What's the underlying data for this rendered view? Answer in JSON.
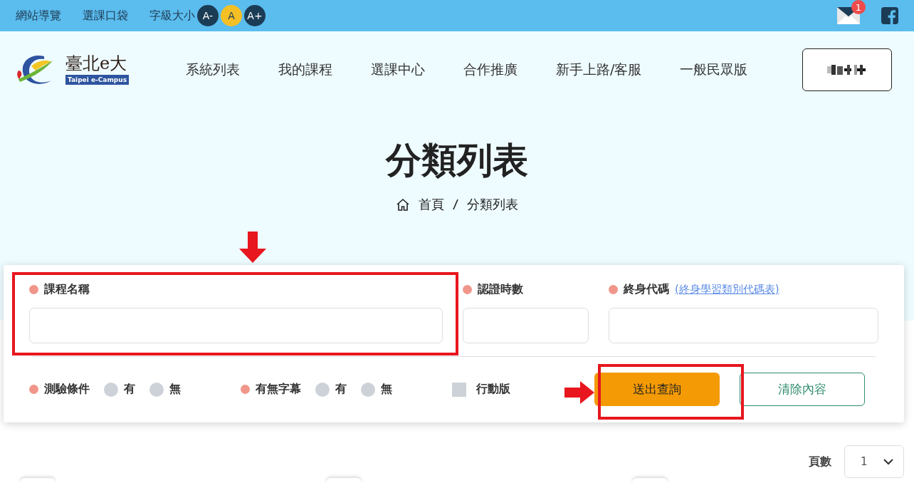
{
  "topbar": {
    "links": [
      "網站導覽",
      "選課口袋"
    ],
    "font_size_label": "字級大小",
    "font_sizes": [
      {
        "label": "A-",
        "selected": false
      },
      {
        "label": "A",
        "selected": true
      },
      {
        "label": "A+",
        "selected": false
      }
    ],
    "mail_count": "1"
  },
  "logo": {
    "title": "臺北e大",
    "subtitle": "Taipei e-Campus"
  },
  "nav": [
    "系統列表",
    "我的課程",
    "選課中心",
    "合作推廣",
    "新手上路/客服",
    "一般民眾版"
  ],
  "page_title": "分類列表",
  "breadcrumb": [
    "首頁",
    "分類列表"
  ],
  "form": {
    "fields": [
      {
        "label": "課程名稱"
      },
      {
        "label": "認證時數"
      },
      {
        "label": "終身代碼",
        "link": "(終身學習類別代碼表)"
      }
    ],
    "options": [
      {
        "kind": "radio",
        "label": "測驗條件",
        "choices": [
          {
            "label": "有",
            "selected": false
          },
          {
            "label": "無",
            "selected": false
          }
        ]
      },
      {
        "kind": "radio",
        "label": "有無字幕",
        "choices": [
          {
            "label": "有",
            "selected": false
          },
          {
            "label": "無",
            "selected": false
          }
        ]
      },
      {
        "kind": "checkbox",
        "label": "行動版",
        "checked": false
      }
    ],
    "buttons": [
      {
        "kind": "primary",
        "label": "送出查詢"
      },
      {
        "kind": "outline",
        "label": "清除內容"
      }
    ]
  },
  "pager": {
    "label": "頁數",
    "value": "1"
  }
}
